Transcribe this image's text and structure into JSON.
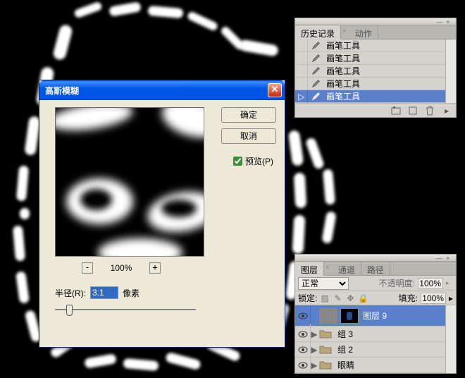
{
  "dialog": {
    "title": "高斯模糊",
    "ok": "确定",
    "cancel": "取消",
    "preview_label": "预览(P)",
    "preview_checked": true,
    "zoom_out": "-",
    "zoom_in": "+",
    "zoom_value": "100%",
    "radius_label": "半径(R):",
    "radius_value": "3.1",
    "radius_unit": "像素"
  },
  "history_panel": {
    "tabs": [
      "历史记录",
      "动作"
    ],
    "active_tab": 0,
    "items": [
      {
        "label": "画笔工具",
        "selected": false
      },
      {
        "label": "画笔工具",
        "selected": false
      },
      {
        "label": "画笔工具",
        "selected": false
      },
      {
        "label": "画笔工具",
        "selected": false
      },
      {
        "label": "画笔工具",
        "selected": true
      }
    ]
  },
  "layers_panel": {
    "tabs": [
      "图层",
      "通道",
      "路径"
    ],
    "active_tab": 0,
    "blend_mode": "正常",
    "opacity_label": "不透明度:",
    "opacity_value": "100%",
    "lock_label": "锁定:",
    "fill_label": "填充:",
    "fill_value": "100%",
    "layers": [
      {
        "name": "图层 9",
        "type": "layer",
        "selected": true,
        "visible": true
      },
      {
        "name": "组 3",
        "type": "group",
        "selected": false,
        "visible": true
      },
      {
        "name": "组 2",
        "type": "group",
        "selected": false,
        "visible": true
      },
      {
        "name": "眼睛",
        "type": "group",
        "selected": false,
        "visible": true
      }
    ]
  }
}
